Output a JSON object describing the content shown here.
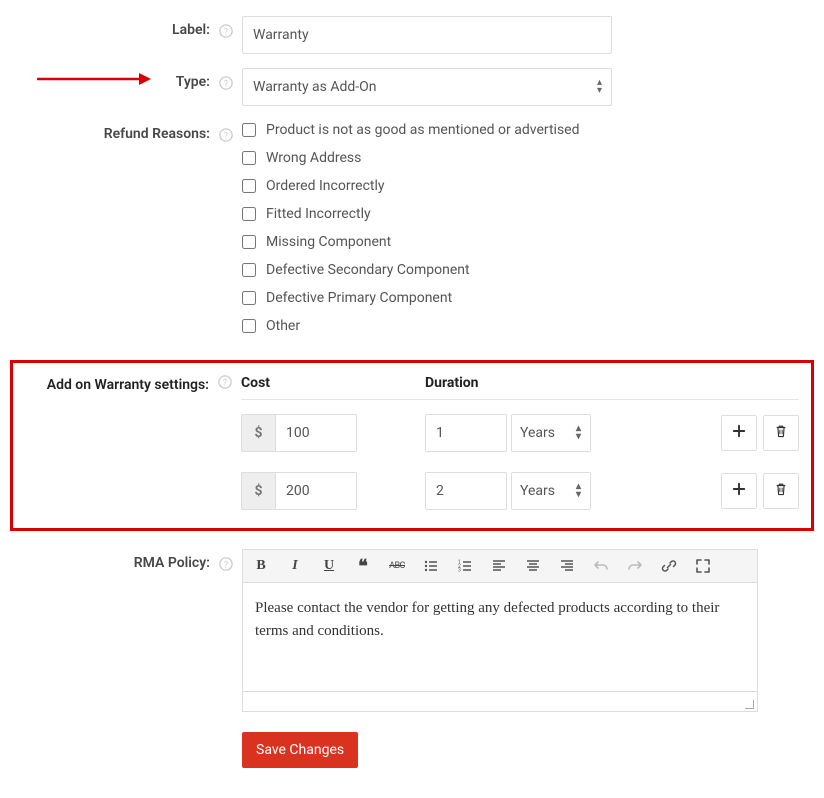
{
  "labels": {
    "label": "Label:",
    "type": "Type:",
    "refund": "Refund Reasons:",
    "warranty": "Add on Warranty settings:",
    "rma": "RMA Policy:"
  },
  "fields": {
    "label_value": "Warranty",
    "type_value": "Warranty as Add-On"
  },
  "refund_reasons": [
    "Product is not as good as mentioned or advertised",
    "Wrong Address",
    "Ordered Incorrectly",
    "Fitted Incorrectly",
    "Missing Component",
    "Defective Secondary Component",
    "Defective Primary Component",
    "Other"
  ],
  "warranty_table": {
    "headers": {
      "cost": "Cost",
      "duration": "Duration"
    },
    "currency": "$",
    "rows": [
      {
        "cost": "100",
        "duration": "1",
        "unit": "Years"
      },
      {
        "cost": "200",
        "duration": "2",
        "unit": "Years"
      }
    ]
  },
  "rma_policy_text": "Please contact the vendor for getting any defected products according to their terms and conditions.",
  "toolbar": {
    "bold": "B",
    "italic": "I",
    "underline": "U",
    "quote": "❝",
    "strike": "ABC"
  },
  "buttons": {
    "save": "Save Changes"
  }
}
